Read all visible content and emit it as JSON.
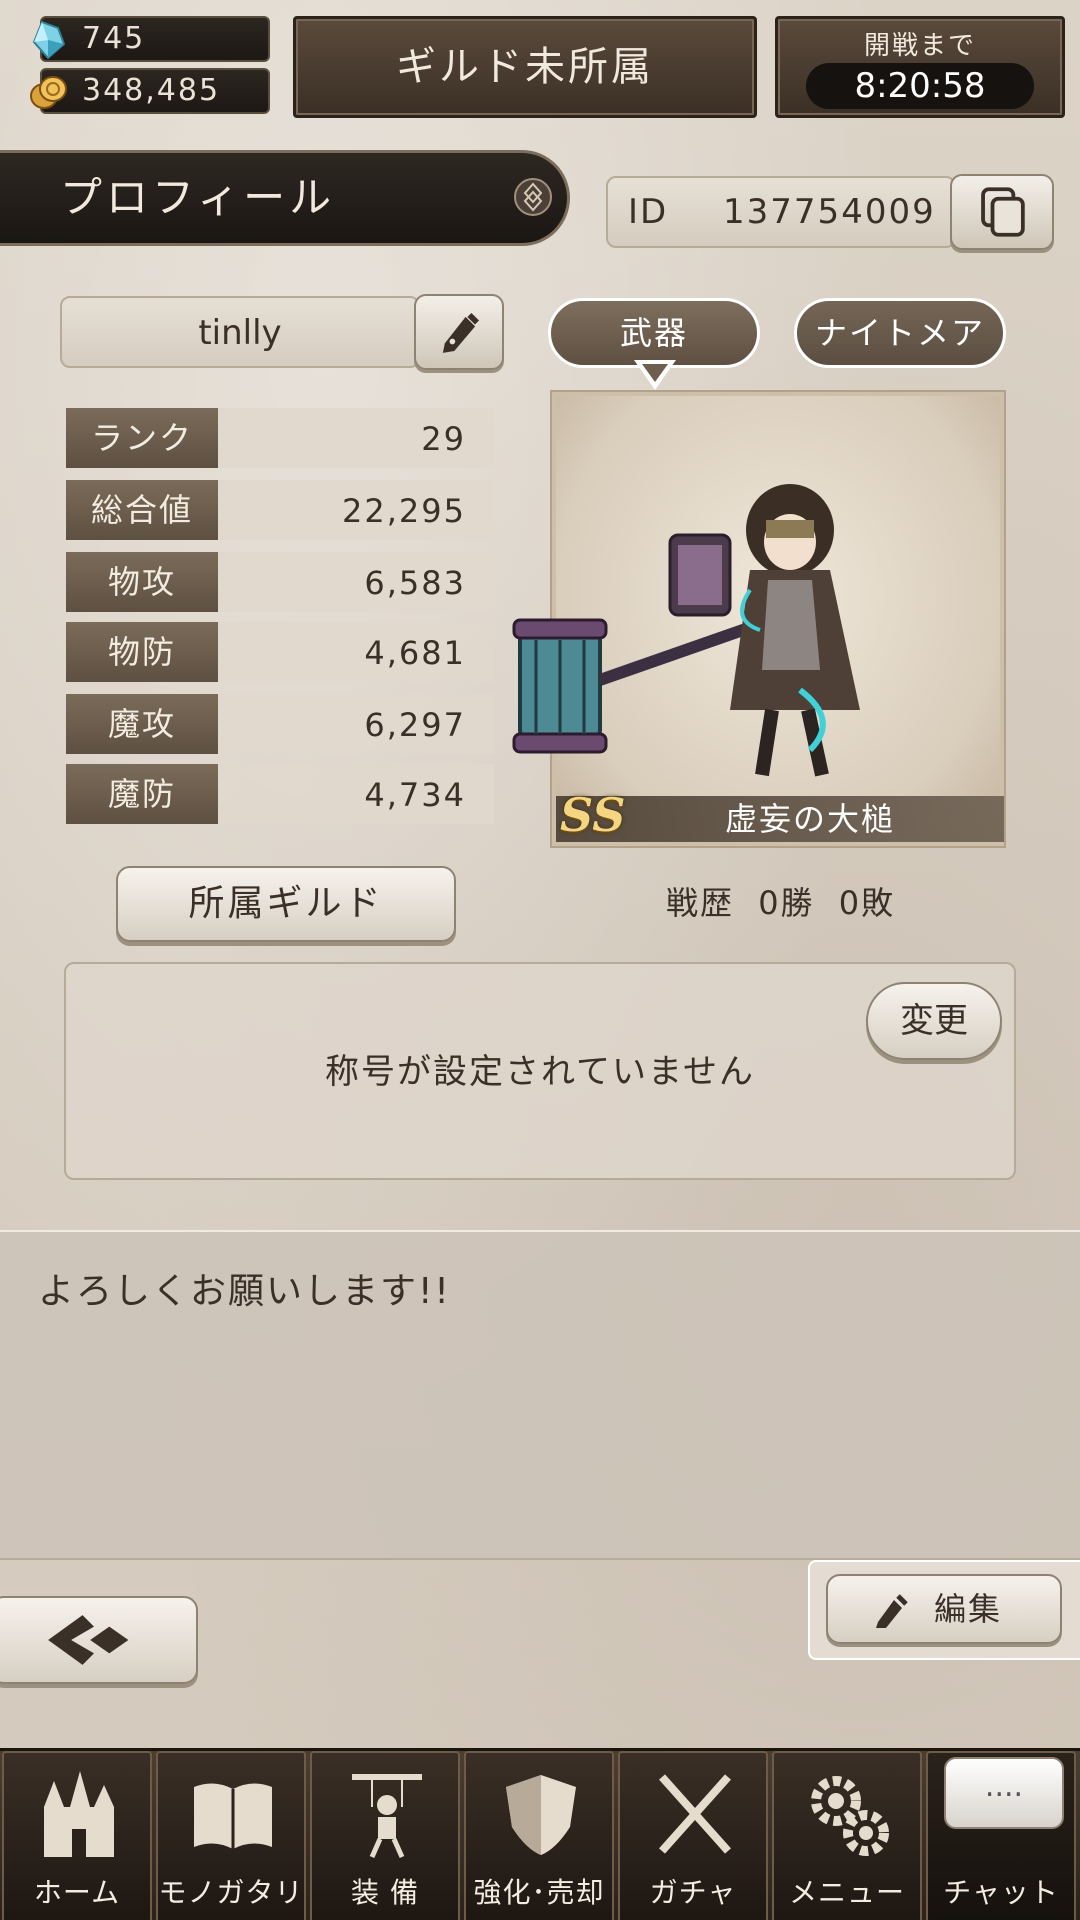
{
  "header": {
    "gems": "745",
    "gold": "348,485",
    "guild_status": "ギルド未所属",
    "timer_label": "開戦まで",
    "timer_value": "8:20:58"
  },
  "profile": {
    "section_title": "プロフィール",
    "id_label": "ID",
    "id_value": "137754009",
    "name": "tinlly"
  },
  "stats": [
    {
      "label": "ランク",
      "value": "29"
    },
    {
      "label": "総合値",
      "value": "22,295"
    },
    {
      "label": "物攻",
      "value": "6,583"
    },
    {
      "label": "物防",
      "value": "4,681"
    },
    {
      "label": "魔攻",
      "value": "6,297"
    },
    {
      "label": "魔防",
      "value": "4,734"
    }
  ],
  "weapon_tabs": {
    "weapon": "武器",
    "nightmare": "ナイトメア"
  },
  "weapon": {
    "rarity": "SS",
    "name": "虚妄の大槌"
  },
  "guild_button": "所属ギルド",
  "record": {
    "label": "戦歴",
    "wins": "0勝",
    "losses": "0敗"
  },
  "title_panel": {
    "text": "称号が設定されていません",
    "change_button": "変更"
  },
  "comment": "よろしくお願いします!!",
  "edit_button": "編集",
  "nav": [
    {
      "label": "ホーム",
      "icon": "castle-icon"
    },
    {
      "label": "モノガタリ",
      "icon": "book-icon"
    },
    {
      "label": "装 備",
      "icon": "puppet-icon"
    },
    {
      "label": "強化･売却",
      "icon": "shield-icon"
    },
    {
      "label": "ガチャ",
      "icon": "swords-icon"
    },
    {
      "label": "メニュー",
      "icon": "gears-icon"
    },
    {
      "label": "チャット",
      "icon": "chat-bubble-icon",
      "bubble": "...."
    }
  ],
  "colors": {
    "parchment": "#d9d0c4",
    "dark_panel": "#2c2620",
    "stat_label_bg": "#6d5e4e",
    "rarity_gold": "#f4d682"
  }
}
